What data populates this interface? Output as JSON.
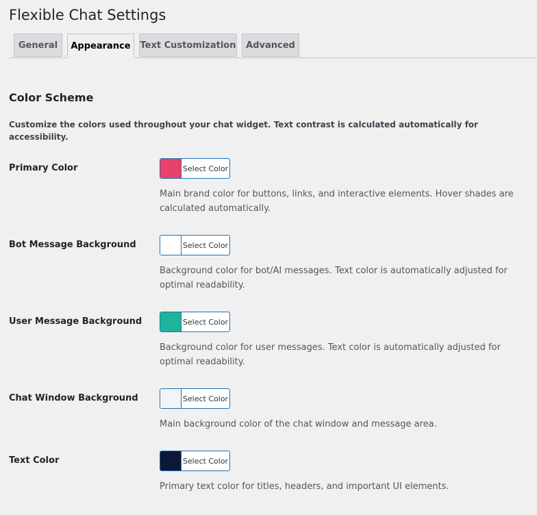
{
  "page": {
    "title": "Flexible Chat Settings"
  },
  "tabs": [
    {
      "label": "General"
    },
    {
      "label": "Appearance"
    },
    {
      "label": "Text Customization"
    },
    {
      "label": "Advanced"
    }
  ],
  "active_tab": "Appearance",
  "section": {
    "title": "Color Scheme",
    "description": "Customize the colors used throughout your chat widget. Text contrast is calculated automatically for accessibility."
  },
  "settings": [
    {
      "label": "Primary Color",
      "color": "#e8416a",
      "button": "Select Color",
      "description": "Main brand color for buttons, links, and interactive elements. Hover shades are calculated automatically."
    },
    {
      "label": "Bot Message Background",
      "color": "#ffffff",
      "button": "Select Color",
      "description": "Background color for bot/AI messages. Text color is automatically adjusted for optimal readability."
    },
    {
      "label": "User Message Background",
      "color": "#1eb39b",
      "button": "Select Color",
      "description": "Background color for user messages. Text color is automatically adjusted for optimal readability."
    },
    {
      "label": "Chat Window Background",
      "color": "#f3f4f8",
      "button": "Select Color",
      "description": "Main background color of the chat window and message area."
    },
    {
      "label": "Text Color",
      "color": "#0f1736",
      "button": "Select Color",
      "description": "Primary text color for titles, headers, and important UI elements."
    }
  ]
}
